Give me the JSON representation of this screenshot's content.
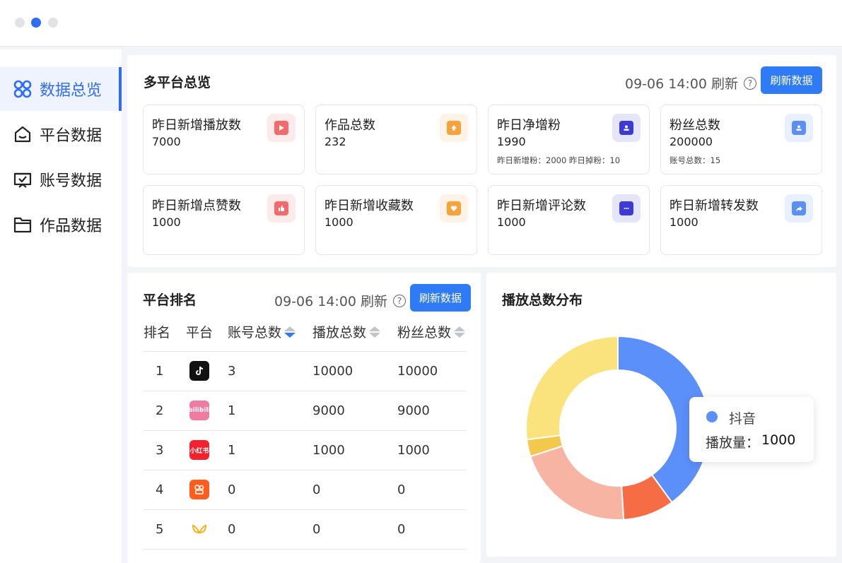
{
  "sidebar": {
    "items": [
      {
        "label": "数据总览",
        "icon": "grid-icon",
        "active": true
      },
      {
        "label": "平台数据",
        "icon": "home-icon",
        "active": false
      },
      {
        "label": "账号数据",
        "icon": "account-icon",
        "active": false
      },
      {
        "label": "作品数据",
        "icon": "folder-icon",
        "active": false
      }
    ]
  },
  "overview": {
    "title": "多平台总览",
    "refresh_time": "09-06 14:00 刷新",
    "refresh_button": "刷新数据",
    "cards": [
      {
        "label": "昨日新增播放数",
        "value": "7000",
        "sub": "",
        "icon": "play-icon",
        "color": "#f26a6a"
      },
      {
        "label": "作品总数",
        "value": "232",
        "sub": "",
        "icon": "upload-icon",
        "color": "#f7a23b"
      },
      {
        "label": "昨日净增粉",
        "value": "1990",
        "sub": "昨日新增粉：2000   昨日掉粉：10",
        "icon": "user-card-icon",
        "color": "#3d3ad6"
      },
      {
        "label": "粉丝总数",
        "value": "200000",
        "sub": "账号总数：15",
        "icon": "user-folder-icon",
        "color": "#5b8ff3"
      },
      {
        "label": "昨日新增点赞数",
        "value": "1000",
        "sub": "",
        "icon": "thumb-icon",
        "color": "#f26a6a"
      },
      {
        "label": "昨日新增收藏数",
        "value": "1000",
        "sub": "",
        "icon": "heart-icon",
        "color": "#f7a23b"
      },
      {
        "label": "昨日新增评论数",
        "value": "1000",
        "sub": "",
        "icon": "comment-icon",
        "color": "#3d3ad6"
      },
      {
        "label": "昨日新增转发数",
        "value": "1000",
        "sub": "",
        "icon": "share-icon",
        "color": "#5b8ff3"
      }
    ]
  },
  "ranking": {
    "title": "平台排名",
    "refresh_time": "09-06 14:00 刷新",
    "refresh_button": "刷新数据",
    "columns": [
      "排名",
      "平台",
      "账号总数",
      "播放总数",
      "粉丝总数"
    ],
    "rows": [
      {
        "rank": "1",
        "platform_icon": "douyin-icon",
        "platform_color": "#111111",
        "platform_text": "",
        "accounts": "3",
        "plays": "10000",
        "fans": "10000"
      },
      {
        "rank": "2",
        "platform_icon": "bilibili-icon",
        "platform_color": "#f07aa0",
        "platform_text": "bilibili",
        "accounts": "1",
        "plays": "9000",
        "fans": "9000"
      },
      {
        "rank": "3",
        "platform_icon": "xiaohongshu-icon",
        "platform_color": "#f5222d",
        "platform_text": "小红书",
        "accounts": "1",
        "plays": "1000",
        "fans": "1000"
      },
      {
        "rank": "4",
        "platform_icon": "kuaishou-icon",
        "platform_color": "#ff5c1e",
        "platform_text": "",
        "accounts": "0",
        "plays": "0",
        "fans": "0"
      },
      {
        "rank": "5",
        "platform_icon": "wechat-video-icon",
        "platform_color": "#f6b21b",
        "platform_text": "",
        "accounts": "0",
        "plays": "0",
        "fans": "0"
      }
    ]
  },
  "distribution": {
    "title": "播放总数分布",
    "tooltip": {
      "name": "抖音",
      "label": "播放量：",
      "value": "1000"
    }
  },
  "chart_data": {
    "type": "pie",
    "title": "播放总数分布",
    "series": [
      {
        "value": 40,
        "color": "#5b8ff9"
      },
      {
        "value": 9,
        "color": "#f66c44"
      },
      {
        "value": 21,
        "color": "#f8b4a3"
      },
      {
        "value": 3,
        "color": "#f2c94c"
      },
      {
        "value": 27,
        "color": "#fae37d"
      }
    ]
  }
}
